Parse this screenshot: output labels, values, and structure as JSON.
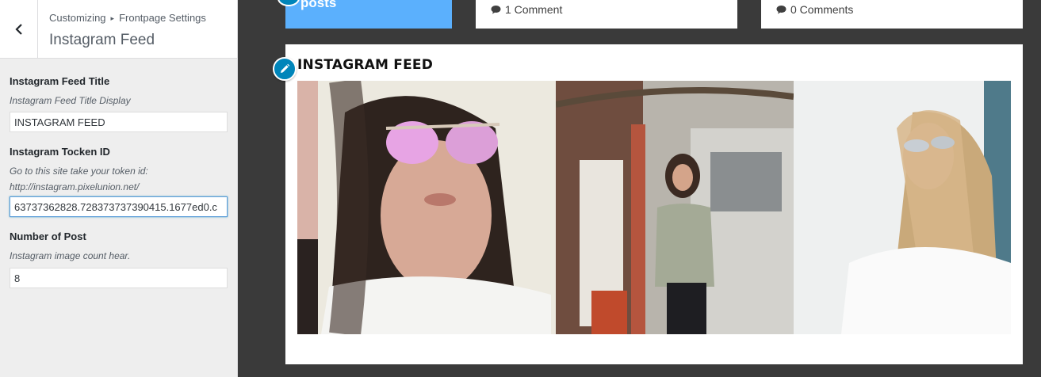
{
  "sidebar": {
    "breadcrumb": {
      "parent": "Customizing",
      "separator": "▸",
      "current": "Frontpage Settings"
    },
    "section_title": "Instagram Feed",
    "controls": [
      {
        "label": "Instagram Feed Title",
        "description": "Instagram Feed Title Display",
        "value": "INSTAGRAM FEED"
      },
      {
        "label": "Instagram Tocken ID",
        "description": "Go to this site take your token id: http://instagram.pixelunion.net/",
        "value": "63737362828.728373737390415.1677ed0.c"
      },
      {
        "label": "Number of Post",
        "description": "Instagram image count hear.",
        "value": "8"
      }
    ]
  },
  "preview": {
    "posts_label": "posts",
    "comments": [
      "1 Comment",
      "0 Comments"
    ],
    "instagram_title": "INSTAGRAM FEED",
    "photos": [
      {
        "subject": "woman with pink mirrored sunglasses selfie"
      },
      {
        "subject": "woman in grey sweater on street by door"
      },
      {
        "subject": "blonde woman in white shirt with sunglasses"
      }
    ]
  },
  "colors": {
    "accent": "#0085ba",
    "posts_bg": "#5bb0fd",
    "preview_bg": "#3a3a3a",
    "focus": "#5b9dd9"
  },
  "icons": [
    "back-chevron-icon",
    "comment-icon",
    "pencil-icon"
  ]
}
